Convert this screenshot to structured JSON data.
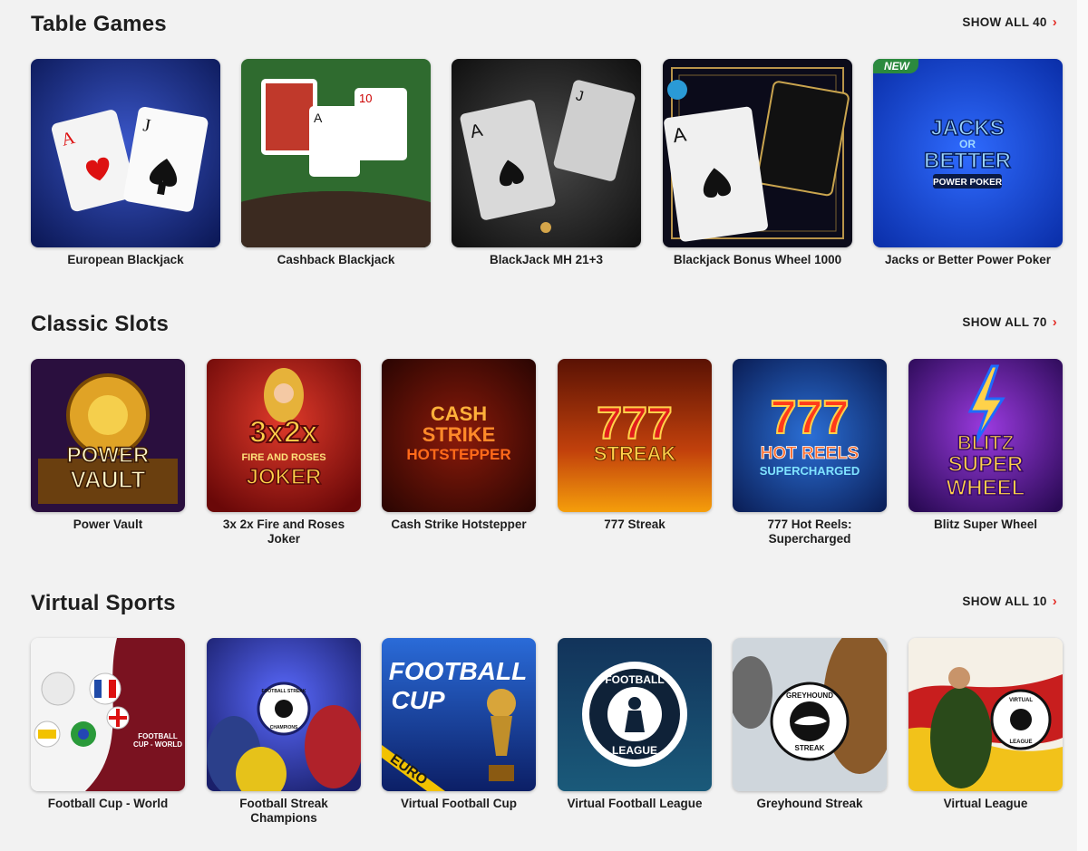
{
  "sections": [
    {
      "title": "Table Games",
      "show_all": "SHOW ALL 40",
      "games": [
        {
          "name": "European Blackjack"
        },
        {
          "name": "Cashback Blackjack"
        },
        {
          "name": "BlackJack MH 21+3"
        },
        {
          "name": "Blackjack Bonus Wheel 1000"
        },
        {
          "name": "Jacks or Better Power Poker",
          "badge": "NEW",
          "art_text": [
            "JACKS",
            "OR",
            "BETTER",
            "POWER POKER"
          ]
        }
      ]
    },
    {
      "title": "Classic Slots",
      "show_all": "SHOW ALL 70",
      "games": [
        {
          "name": "Power Vault",
          "art_text": [
            "POWER",
            "VAULT"
          ]
        },
        {
          "name": "3x 2x Fire and Roses Joker",
          "art_text": [
            "3x2x",
            "FIRE AND ROSES",
            "JOKER"
          ]
        },
        {
          "name": "Cash Strike Hotstepper",
          "art_text": [
            "CASH",
            "STRIKE",
            "HOTSTEPPER"
          ]
        },
        {
          "name": "777 Streak",
          "art_text": [
            "777",
            "STREAK"
          ]
        },
        {
          "name": "777 Hot Reels: Supercharged",
          "art_text": [
            "777",
            "HOT REELS",
            "SUPERCHARGED"
          ]
        },
        {
          "name": "Blitz Super Wheel",
          "art_text": [
            "BLITZ",
            "SUPER",
            "WHEEL"
          ]
        }
      ]
    },
    {
      "title": "Virtual Sports",
      "show_all": "SHOW ALL 10",
      "games": [
        {
          "name": "Football Cup - World",
          "art_text": [
            "FOOTBALL",
            "CUP - WORLD"
          ]
        },
        {
          "name": "Football Streak Champions",
          "art_text": [
            "FOOTBALL STREAK",
            "CHAMPIONS"
          ]
        },
        {
          "name": "Virtual Football Cup",
          "art_text": [
            "FOOTBALL",
            "CUP",
            "EURO"
          ]
        },
        {
          "name": "Virtual Football League",
          "art_text": [
            "FOOTBALL",
            "LEAGUE"
          ]
        },
        {
          "name": "Greyhound Streak",
          "art_text": [
            "GREYHOUND",
            "STREAK"
          ]
        },
        {
          "name": "Virtual League",
          "art_text": [
            "VIRTUAL",
            "LEAGUE"
          ]
        }
      ]
    }
  ],
  "colors": {
    "accent": "#e4312b",
    "badge": "#2b8a3e"
  }
}
